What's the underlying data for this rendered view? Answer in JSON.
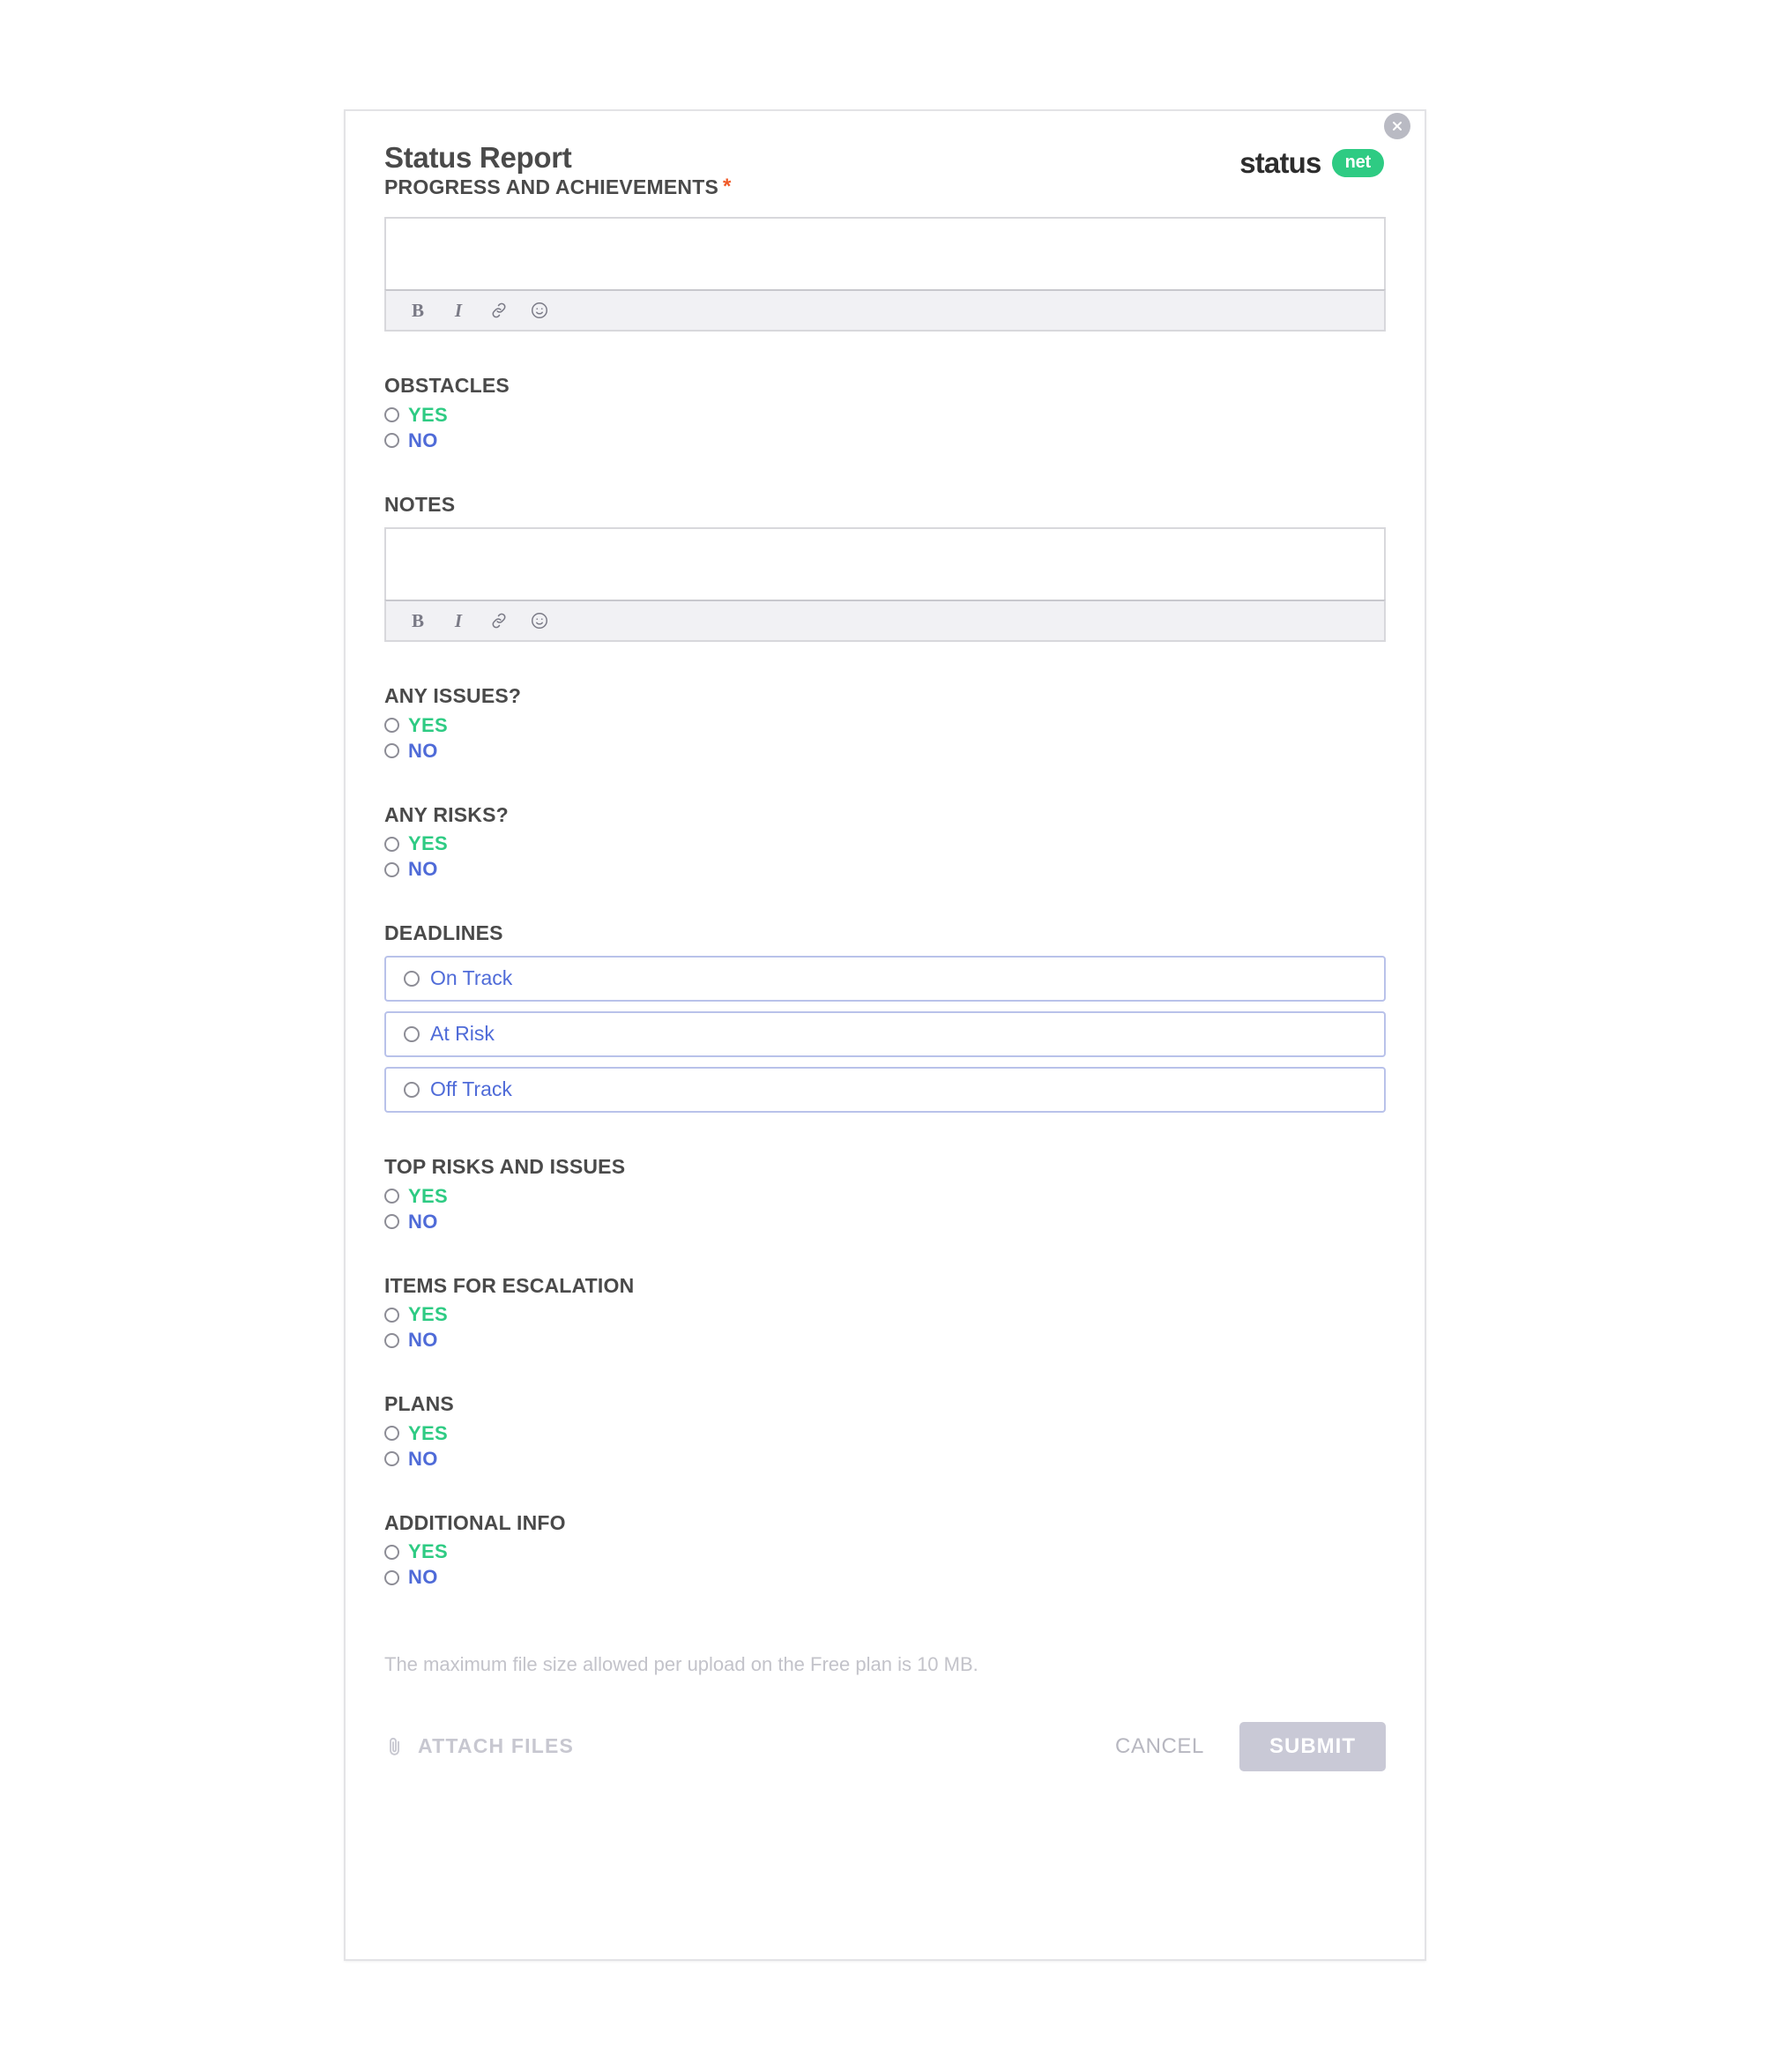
{
  "modal": {
    "title": "Status Report",
    "close_icon": "close-icon",
    "brand": {
      "word": "status",
      "pill": "net"
    }
  },
  "editor": {
    "toolbar": [
      {
        "icon": "bold-icon",
        "label": "B"
      },
      {
        "icon": "italic-icon",
        "label": "I"
      },
      {
        "icon": "link-icon",
        "label": ""
      },
      {
        "icon": "emoji-icon",
        "label": ""
      }
    ]
  },
  "fields": {
    "progress": {
      "label": "PROGRESS AND ACHIEVEMENTS",
      "required": true,
      "required_mark": "*",
      "value": ""
    },
    "notes": {
      "label": "NOTES",
      "required": false,
      "value": ""
    }
  },
  "yes_no": {
    "yes": "YES",
    "no": "NO"
  },
  "sections": [
    {
      "key": "obstacles",
      "label": "OBSTACLES"
    },
    {
      "key": "any_issues",
      "label": "ANY ISSUES?"
    },
    {
      "key": "any_risks",
      "label": "ANY RISKS?"
    },
    {
      "key": "top_risks",
      "label": "TOP RISKS AND ISSUES"
    },
    {
      "key": "escalation",
      "label": "ITEMS FOR ESCALATION"
    },
    {
      "key": "plans",
      "label": "PLANS"
    },
    {
      "key": "additional",
      "label": "ADDITIONAL INFO"
    }
  ],
  "deadlines": {
    "label": "DEADLINES",
    "options": [
      {
        "label": "On Track",
        "selected": false
      },
      {
        "label": "At Risk",
        "selected": false
      },
      {
        "label": "Off Track",
        "selected": false
      }
    ]
  },
  "footer": {
    "upload_note": "The maximum file size allowed per upload on the Free plan is 10 MB.",
    "attach_label": "ATTACH FILES",
    "attach_icon": "paperclip-icon",
    "cancel_label": "CANCEL",
    "submit_label": "SUBMIT",
    "submit_disabled": true
  },
  "colors": {
    "yes": "#2ecb83",
    "no": "#4f6bd8",
    "required": "#f05a28",
    "brand_pill": "#2ecb83",
    "submit_disabled": "#c9c9d6",
    "deadline_border": "#b9c2ea"
  }
}
